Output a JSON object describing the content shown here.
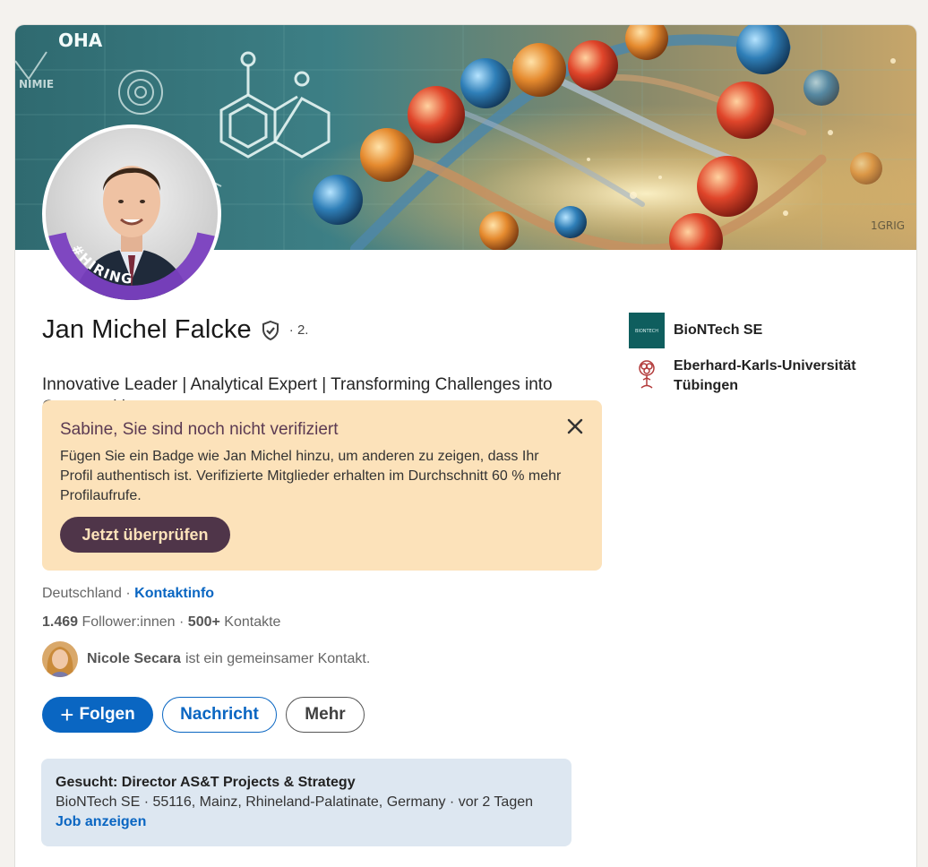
{
  "profile": {
    "name": "Jan Michel Falcke",
    "degree": "· 2.",
    "headline": "Innovative Leader | Analytical Expert | Transforming Challenges into Opportunities",
    "badge": "#HIRING",
    "cover_text": {
      "formula": "OHA",
      "left": "NIMIE",
      "right": "1GRIG"
    }
  },
  "verify_banner": {
    "title": "Sabine, Sie sind noch nicht verifiziert",
    "text": "Fügen Sie ein Badge wie Jan Michel hinzu, um anderen zu zeigen, dass Ihr Profil authentisch ist. Verifizierte Mitglieder erhalten im Durchschnitt 60 % mehr Profilaufrufe.",
    "button": "Jetzt überprüfen",
    "bg_color": "#fce2ba",
    "accent_color": "#4f3549"
  },
  "location": {
    "country": "Deutschland",
    "separator": " · ",
    "contact_link": "Kontaktinfo"
  },
  "network": {
    "followers": "1.469",
    "followers_label": "Follower:innen",
    "separator": " · ",
    "connections": "500+",
    "connections_label": "Kontakte"
  },
  "mutual": {
    "name": "Nicole Secara",
    "text": "ist ein gemeinsamer Kontakt."
  },
  "actions": {
    "follow": "Folgen",
    "follow_icon": "plus-icon",
    "message": "Nachricht",
    "more": "Mehr",
    "primary_color": "#0a66c2"
  },
  "job": {
    "title": "Gesucht: Director AS&T Projects & Strategy",
    "meta": "BioNTech SE · 55116, Mainz, Rhineland-Palatinate, Germany · vor 2 Tagen",
    "link": "Job anzeigen"
  },
  "sidebar": {
    "items": [
      {
        "label": "BioNTech SE",
        "logo_text": "BIONTECH",
        "icon": "biontech-logo"
      },
      {
        "label": "Eberhard-Karls-Universität Tübingen",
        "icon": "university-logo"
      }
    ]
  }
}
